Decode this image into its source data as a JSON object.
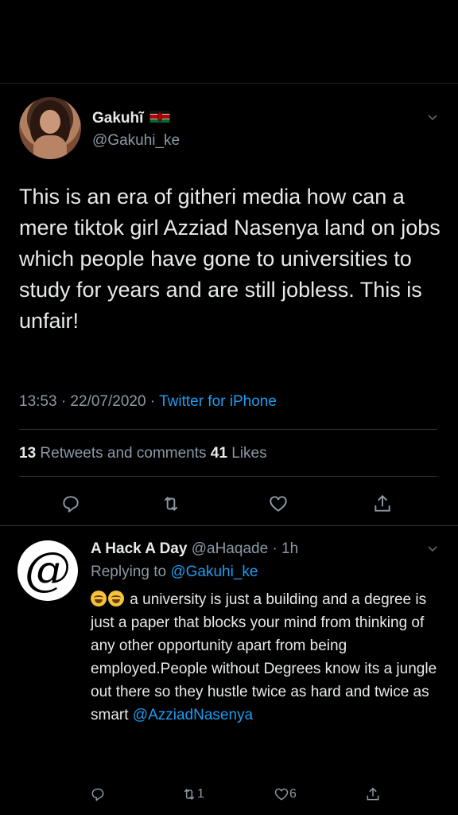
{
  "main_tweet": {
    "name": "Gakuhĩ",
    "handle": "@Gakuhi_ke",
    "flag_icon": "kenya-flag-icon",
    "text": "This is an era of githeri media how can a mere tiktok girl Azziad Nasenya land on jobs which people have gone to universities to study for years and are still jobless. This is unfair!",
    "time": "13:53 · 22/07/2020 · ",
    "source": "Twitter for iPhone",
    "retweets_count": "13",
    "retweets_label": " Retweets and comments  ",
    "likes_count": "41",
    "likes_label": " Likes",
    "actions": [
      "reply-icon",
      "retweet-icon",
      "like-icon",
      "share-icon"
    ]
  },
  "reply_tweet": {
    "avatar_glyph": "@",
    "name": "A Hack A Day",
    "handle_time": " @aHaqade · 1h",
    "replying_prefix": "Replying to ",
    "replying_handle": "@Gakuhi_ke",
    "text": " a university is just a building and a degree is just a paper that blocks your mind from thinking of any other opportunity apart from being employed.People without Degrees know its a jungle out there so they hustle twice as hard and twice as smart ",
    "mention": "@AzziadNasenya",
    "retweet_count": "1",
    "like_count": "6"
  },
  "colors": {
    "background": "#000000",
    "text": "#e7e9ea",
    "secondary": "#8b98a5",
    "accent": "#1d9bf0"
  }
}
